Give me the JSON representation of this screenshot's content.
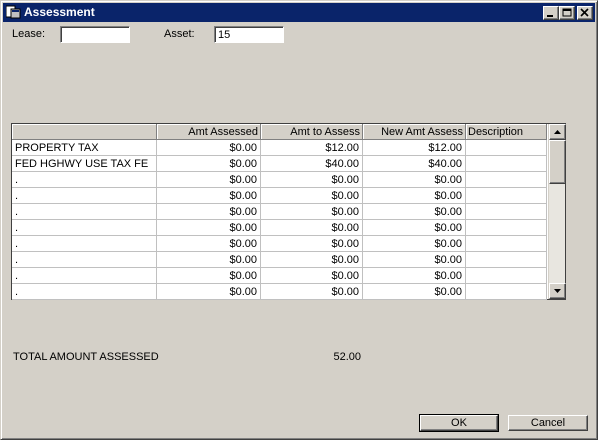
{
  "window": {
    "title": "Assessment"
  },
  "form": {
    "lease_label": "Lease:",
    "lease_value": "",
    "asset_label": "Asset:",
    "asset_value": "15"
  },
  "grid": {
    "columns": [
      "",
      "Amt Assessed",
      "Amt to Assess",
      "New Amt Assess",
      "Description"
    ],
    "rows": [
      [
        "PROPERTY TAX",
        "$0.00",
        "$12.00",
        "$12.00",
        ""
      ],
      [
        "FED HGHWY USE TAX FE",
        "$0.00",
        "$40.00",
        "$40.00",
        ""
      ],
      [
        ".",
        "$0.00",
        "$0.00",
        "$0.00",
        ""
      ],
      [
        ".",
        "$0.00",
        "$0.00",
        "$0.00",
        ""
      ],
      [
        ".",
        "$0.00",
        "$0.00",
        "$0.00",
        ""
      ],
      [
        ".",
        "$0.00",
        "$0.00",
        "$0.00",
        ""
      ],
      [
        ".",
        "$0.00",
        "$0.00",
        "$0.00",
        ""
      ],
      [
        ".",
        "$0.00",
        "$0.00",
        "$0.00",
        ""
      ],
      [
        ".",
        "$0.00",
        "$0.00",
        "$0.00",
        ""
      ],
      [
        ".",
        "$0.00",
        "$0.00",
        "$0.00",
        ""
      ]
    ]
  },
  "totals": {
    "label": "TOTAL AMOUNT ASSESSED",
    "value": "52.00"
  },
  "buttons": {
    "ok": "OK",
    "cancel": "Cancel"
  },
  "icons": {
    "app": "app-window-icon",
    "minimize": "minimize-icon",
    "maximize": "maximize-icon",
    "close": "close-icon",
    "scroll_up": "arrow-up-icon",
    "scroll_down": "arrow-down-icon"
  },
  "colors": {
    "titlebar": "#0a246a",
    "face": "#d4d0c8"
  }
}
